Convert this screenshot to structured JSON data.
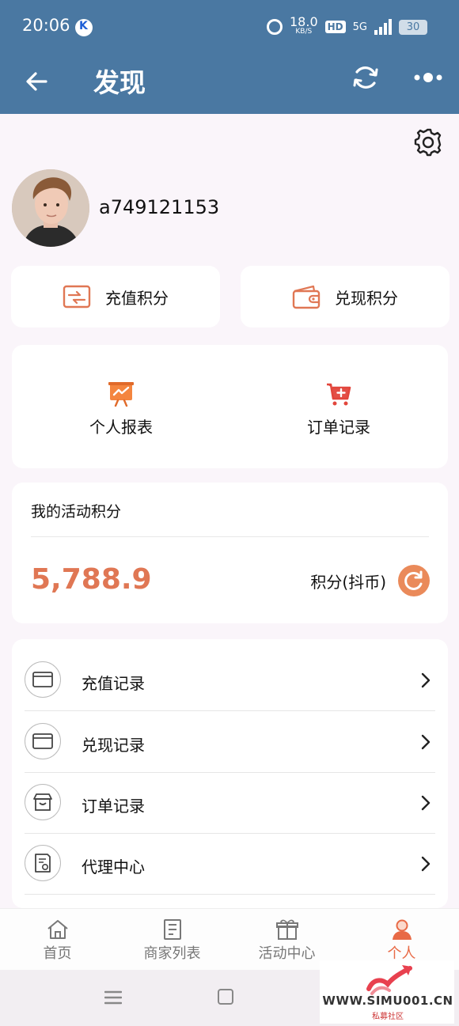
{
  "status_bar": {
    "time": "20:06",
    "speed_value": "18.0",
    "speed_unit": "KB/S",
    "hd": "HD",
    "network": "5G",
    "battery": "30"
  },
  "app_bar": {
    "title": "发现"
  },
  "profile": {
    "username": "a749121153"
  },
  "actions": {
    "recharge_label": "充值积分",
    "withdraw_label": "兑现积分"
  },
  "features": {
    "report_label": "个人报表",
    "orders_label": "订单记录"
  },
  "points": {
    "title": "我的活动积分",
    "value": "5,788.9",
    "unit": "积分(抖币)"
  },
  "menu": {
    "items": [
      {
        "label": "充值记录",
        "icon": "card-icon"
      },
      {
        "label": "兑现记录",
        "icon": "card-icon"
      },
      {
        "label": "订单记录",
        "icon": "store-icon"
      },
      {
        "label": "代理中心",
        "icon": "certificate-icon"
      }
    ]
  },
  "tabs": [
    {
      "label": "首页",
      "icon": "home-icon"
    },
    {
      "label": "商家列表",
      "icon": "list-icon"
    },
    {
      "label": "活动中心",
      "icon": "gift-icon"
    },
    {
      "label": "个人",
      "icon": "person-icon",
      "active": true
    }
  ],
  "watermark": {
    "url": "WWW.SIMU001.CN",
    "sub": "私募社区"
  },
  "colors": {
    "header": "#4a78a2",
    "accent": "#e07754",
    "background": "#faf5fa"
  }
}
